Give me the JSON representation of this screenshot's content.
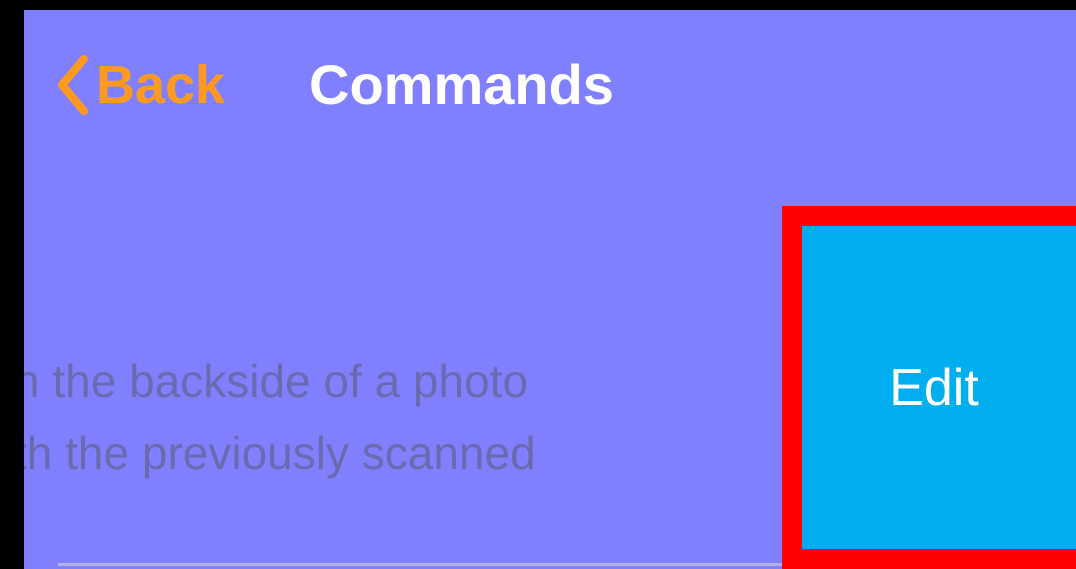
{
  "nav": {
    "back_label": "Back",
    "title": "Commands"
  },
  "cell": {
    "title_fragment": "",
    "description_lines": [
      "n the backside of a photo",
      "th the previously scanned"
    ]
  },
  "swipe_action": {
    "edit_label": "Edit"
  },
  "colors": {
    "background": "#8080ff",
    "accent": "#ff9a1f",
    "edit_action": "#00aef0",
    "highlight": "#ff0000"
  },
  "icons": {
    "back": "chevron-left-icon"
  }
}
